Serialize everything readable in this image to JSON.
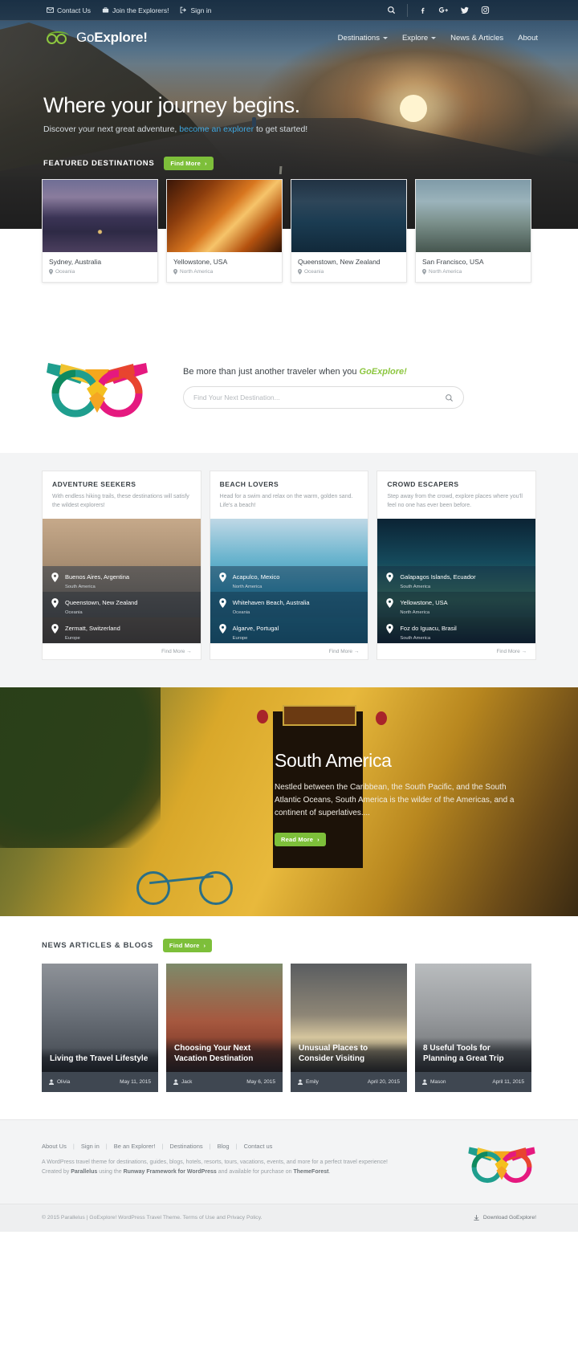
{
  "topbar": {
    "items": [
      {
        "label": "Contact Us",
        "icon": "envelope-icon"
      },
      {
        "label": "Join the Explorers!",
        "icon": "suitcase-icon"
      },
      {
        "label": "Sign in",
        "icon": "sign-in-icon"
      }
    ],
    "icons": [
      "search-icon",
      "facebook-icon",
      "google-plus-icon",
      "twitter-icon",
      "instagram-icon"
    ]
  },
  "brand": {
    "go": "Go",
    "explore": "Explore!",
    "mark": "owl-logo-icon"
  },
  "nav": {
    "items": [
      {
        "label": "Destinations",
        "has_dropdown": true
      },
      {
        "label": "Explore",
        "has_dropdown": true
      },
      {
        "label": "News & Articles",
        "has_dropdown": false
      },
      {
        "label": "About",
        "has_dropdown": false
      }
    ]
  },
  "hero": {
    "title": "Where your journey begins.",
    "sub_before": "Discover your next great adventure, ",
    "sub_link": "become an explorer",
    "sub_after": " to get started!"
  },
  "featured": {
    "title": "FEATURED DESTINATIONS",
    "find_more": "Find More",
    "cards": [
      {
        "name": "Sydney, Australia",
        "region": "Oceania",
        "img": "img-sydney"
      },
      {
        "name": "Yellowstone, USA",
        "region": "North America",
        "img": "img-yellow"
      },
      {
        "name": "Queenstown, New Zealand",
        "region": "Oceania",
        "img": "img-queens"
      },
      {
        "name": "San Francisco, USA",
        "region": "North America",
        "img": "img-sf"
      }
    ]
  },
  "search": {
    "tagline_before": "Be more than just another traveler when you ",
    "tagline_brand": "GoExplore!",
    "placeholder": "Find Your Next Destination...",
    "value": "",
    "icon": "search-icon"
  },
  "categories": [
    {
      "title": "ADVENTURE SEEKERS",
      "desc": "With endless hiking trails, these destinations will satisfy the wildest explorers!",
      "bg": "bg-ba",
      "find_more": "Find More",
      "places": [
        {
          "name": "Buenos Aires, Argentina",
          "region": "South America"
        },
        {
          "name": "Queenstown, New Zealand",
          "region": "Oceania"
        },
        {
          "name": "Zermatt, Switzerland",
          "region": "Europe"
        }
      ]
    },
    {
      "title": "BEACH LOVERS",
      "desc": "Head for a swim and relax on the warm, golden sand. Life's a beach!",
      "bg": "bg-ac",
      "find_more": "Find More",
      "places": [
        {
          "name": "Acapulco, Mexico",
          "region": "North America"
        },
        {
          "name": "Whitehaven Beach, Australia",
          "region": "Oceania"
        },
        {
          "name": "Algarve, Portugal",
          "region": "Europe"
        }
      ]
    },
    {
      "title": "CROWD ESCAPERS",
      "desc": "Step away from the crowd, explore places where you'll feel no one has ever been before.",
      "bg": "bg-gl",
      "find_more": "Find More",
      "places": [
        {
          "name": "Galapagos Islands, Ecuador",
          "region": "South America"
        },
        {
          "name": "Yellowstone, USA",
          "region": "North America"
        },
        {
          "name": "Foz do Iguacu, Brasil",
          "region": "South America"
        }
      ]
    }
  ],
  "feature_region": {
    "title": "South America",
    "text": "Nestled between the Caribbean, the South Pacific, and the South Atlantic Oceans, South America is the wilder of the Americas, and a continent of superlatives....",
    "button": "Read More"
  },
  "news": {
    "title": "NEWS ARTICLES & BLOGS",
    "find_more": "Find More",
    "posts": [
      {
        "title": "Living the Travel Lifestyle",
        "author": "Olivia",
        "date": "May 11, 2015",
        "img": "img-brook"
      },
      {
        "title": "Choosing Your Next Vacation Destination",
        "author": "Jack",
        "date": "May 6, 2015",
        "img": "img-vac"
      },
      {
        "title": "Unusual Places to Consider Visiting",
        "author": "Emily",
        "date": "April 20, 2015",
        "img": "img-rail"
      },
      {
        "title": "8 Useful Tools for Planning a Great Trip",
        "author": "Mason",
        "date": "April 11, 2015",
        "img": "img-london"
      }
    ]
  },
  "footer": {
    "links": [
      "About Us",
      "Sign in",
      "Be an Explorer!",
      "Destinations",
      "Blog",
      "Contact us"
    ],
    "line1": "A WordPress travel theme for destinations, guides, blogs, hotels, resorts, tours, vacations, events, and more for a perfect travel experience!",
    "line2_a": "Created by ",
    "line2_b": "Parallelus",
    "line2_c": " using the ",
    "line2_d": "Runway Framework for WordPress",
    "line2_e": " and available for purchase on ",
    "line2_f": "ThemeForest",
    "line2_g": ".",
    "copyright": "© 2015 Parallelus | GoExplore! WordPress Travel Theme. Terms of Use and Privacy Policy.",
    "download": "Download GoExplore!",
    "download_icon": "download-icon"
  },
  "colors": {
    "green": "#7dbf3a",
    "brand_green": "#8cc63f",
    "link_blue": "#3ea7e0",
    "dark": "#3f4751"
  }
}
